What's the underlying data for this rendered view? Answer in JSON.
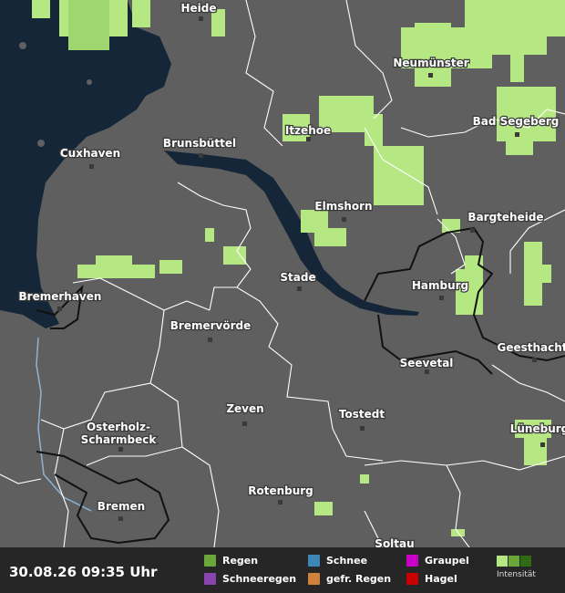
{
  "map": {
    "cities": [
      {
        "name": "Heide"
      },
      {
        "name": "Neumünster"
      },
      {
        "name": "Bad Segeberg"
      },
      {
        "name": "Cuxhaven"
      },
      {
        "name": "Brunsbüttel"
      },
      {
        "name": "Itzehoe"
      },
      {
        "name": "Elmshorn"
      },
      {
        "name": "Bargteheide"
      },
      {
        "name": "Stade"
      },
      {
        "name": "Hamburg"
      },
      {
        "name": "Bremerhaven"
      },
      {
        "name": "Bremervörde"
      },
      {
        "name": "Geesthacht"
      },
      {
        "name": "Seevetal"
      },
      {
        "name": "Zeven"
      },
      {
        "name": "Tostedt"
      },
      {
        "name": "Osterholz-"
      },
      {
        "name": "Scharmbeck"
      },
      {
        "name": "Lüneburg"
      },
      {
        "name": "Bremen"
      },
      {
        "name": "Rotenburg"
      },
      {
        "name": "Soltau"
      }
    ],
    "colors": {
      "land": "#5f5f5f",
      "water": "#142638",
      "rain_light": "#b5e883",
      "border": "#ffffff",
      "state_border": "#111111"
    }
  },
  "footer": {
    "timestamp": "30.08.26 09:35 Uhr",
    "legend": [
      {
        "label": "Regen",
        "color": "#6aa638"
      },
      {
        "label": "Schnee",
        "color": "#3d86b8"
      },
      {
        "label": "Graupel",
        "color": "#c800c8"
      },
      {
        "label": "Schneeregen",
        "color": "#8a44b0"
      },
      {
        "label": "gefr. Regen",
        "color": "#d0823a"
      },
      {
        "label": "Hagel",
        "color": "#c80000"
      }
    ],
    "intensity_label": "Intensität",
    "intensity_colors": [
      "#b5e883",
      "#6aa638",
      "#2f6b12"
    ]
  }
}
